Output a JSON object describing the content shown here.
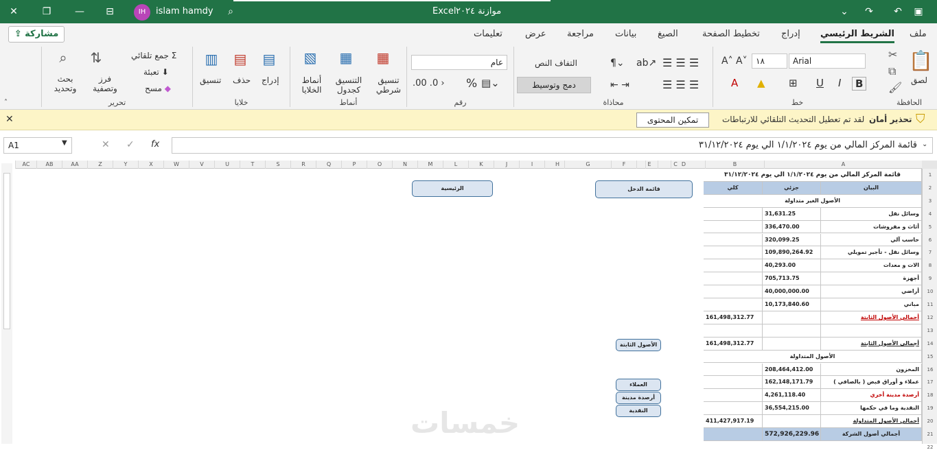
{
  "titlebar": {
    "file": "موازنة ٢٠٢٤",
    "app": "Excel",
    "user": "islam hamdy",
    "initials": "IH"
  },
  "tabs": [
    "ملف",
    "الشريط الرئيسي",
    "إدراج",
    "تخطيط الصفحة",
    "الصيغ",
    "بيانات",
    "مراجعة",
    "عرض",
    "تعليمات"
  ],
  "share_label": "مشاركة",
  "ribbon": {
    "clipboard": {
      "label": "الحافظة",
      "paste": "لصق"
    },
    "font": {
      "label": "خط",
      "name": "Arial",
      "size": "١٨",
      "bold": "B",
      "italic": "I",
      "underline": "U"
    },
    "alignment": {
      "label": "محاذاة",
      "wrap": "التفاف النص",
      "merge": "دمج وتوسيط"
    },
    "number": {
      "label": "رقم",
      "format": "عام"
    },
    "styles": {
      "label": "أنماط",
      "conditional": "تنسيق شرطي",
      "table": "التنسيق كجدول",
      "cell": "أنماط الخلايا"
    },
    "cells": {
      "label": "خلايا",
      "insert": "إدراج",
      "delete": "حذف",
      "format": "تنسيق"
    },
    "editing": {
      "label": "تحرير",
      "autosum": "جمع تلقائي",
      "fill": "تعبئة",
      "clear": "مسح",
      "sort": "فرز وتصفية",
      "find": "بحث وتحديد"
    }
  },
  "warning": {
    "title": "تحذير أمان",
    "message": "لقد تم تعطيل التحديث التلقائي للارتباطات",
    "button": "تمكين المحتوى"
  },
  "namebox": "A1",
  "formula": "قائمة المركز المالي من يوم ١/١/٢٠٢٤ الي يوم ٣١/١٢/٢٠٢٤",
  "columns": [
    "A",
    "B",
    "C",
    "D",
    "E",
    "F",
    "G",
    "H",
    "I",
    "J",
    "K",
    "L",
    "M",
    "N",
    "O",
    "P",
    "Q",
    "R",
    "S",
    "T",
    "U",
    "V",
    "W",
    "X",
    "Y",
    "Z",
    "AA",
    "AB",
    "AC"
  ],
  "rows": [
    "1",
    "2",
    "3",
    "4",
    "5",
    "6",
    "7",
    "8",
    "9",
    "10",
    "11",
    "12",
    "13",
    "14",
    "15",
    "16",
    "17",
    "18",
    "19",
    "20",
    "21",
    "22"
  ],
  "sheet": {
    "title": "قائمة المركز المالي من يوم ١/١/٢٠٢٤ الي يوم ٣١/١٢/٢٠٢٤",
    "head": [
      "البيان",
      "جزئي",
      "كلي"
    ],
    "noncurrent_title": "الأصول الغير متداولة",
    "current_title": "الأصول المتداولة",
    "lines": [
      {
        "label": "وسائل نقل",
        "partial": "31,631.25",
        "total": ""
      },
      {
        "label": "أثاث و مفروشات",
        "partial": "336,470.00",
        "total": ""
      },
      {
        "label": "حاسب آلي",
        "partial": "320,099.25",
        "total": ""
      },
      {
        "label": "وسائل نقل - تأجير تمويلي",
        "partial": "109,890,264.92",
        "total": ""
      },
      {
        "label": "الات و معدات",
        "partial": "40,293.00",
        "total": ""
      },
      {
        "label": "أجهزة",
        "partial": "705,713.75",
        "total": ""
      },
      {
        "label": "أراضي",
        "partial": "40,000,000.00",
        "total": ""
      },
      {
        "label": "مباني",
        "partial": "10,173,840.60",
        "total": ""
      },
      {
        "label": "أجمالي الأصول الثابتة",
        "partial": "",
        "total": "161,498,312.77"
      },
      {
        "label": "",
        "partial": "",
        "total": ""
      },
      {
        "label": "أجمالي الأصول الثابتة",
        "partial": "",
        "total": "161,498,312.77"
      }
    ],
    "current": [
      {
        "label": "المخزون",
        "partial": "208,464,412.00",
        "total": ""
      },
      {
        "label": "عملاء و أوراق قبض ( بالصافي )",
        "partial": "162,148,171.79",
        "total": ""
      },
      {
        "label": "أرصدة مدينة أخري",
        "partial": "4,261,118.40",
        "total": ""
      },
      {
        "label": "النقدية وما في حكمها",
        "partial": "36,554,215.00",
        "total": ""
      },
      {
        "label": "أجمالي الأصول المتداولة",
        "partial": "",
        "total": "411,427,917.19"
      }
    ],
    "grand": {
      "label": "أجمالي أصول الشركة",
      "partial": "572,926,229.96"
    }
  },
  "shapes": {
    "home": "الرئيسية",
    "income": "قائمة الدخل",
    "fixed": "الأصول الثابتة",
    "customers": "العملاء",
    "debit": "أرصدة مدينة",
    "cash": "النقدية"
  },
  "watermark": "خمسات",
  "colors": {
    "excel_green": "#217346",
    "header_fill": "#b8cce4",
    "red_text": "#c00000"
  }
}
